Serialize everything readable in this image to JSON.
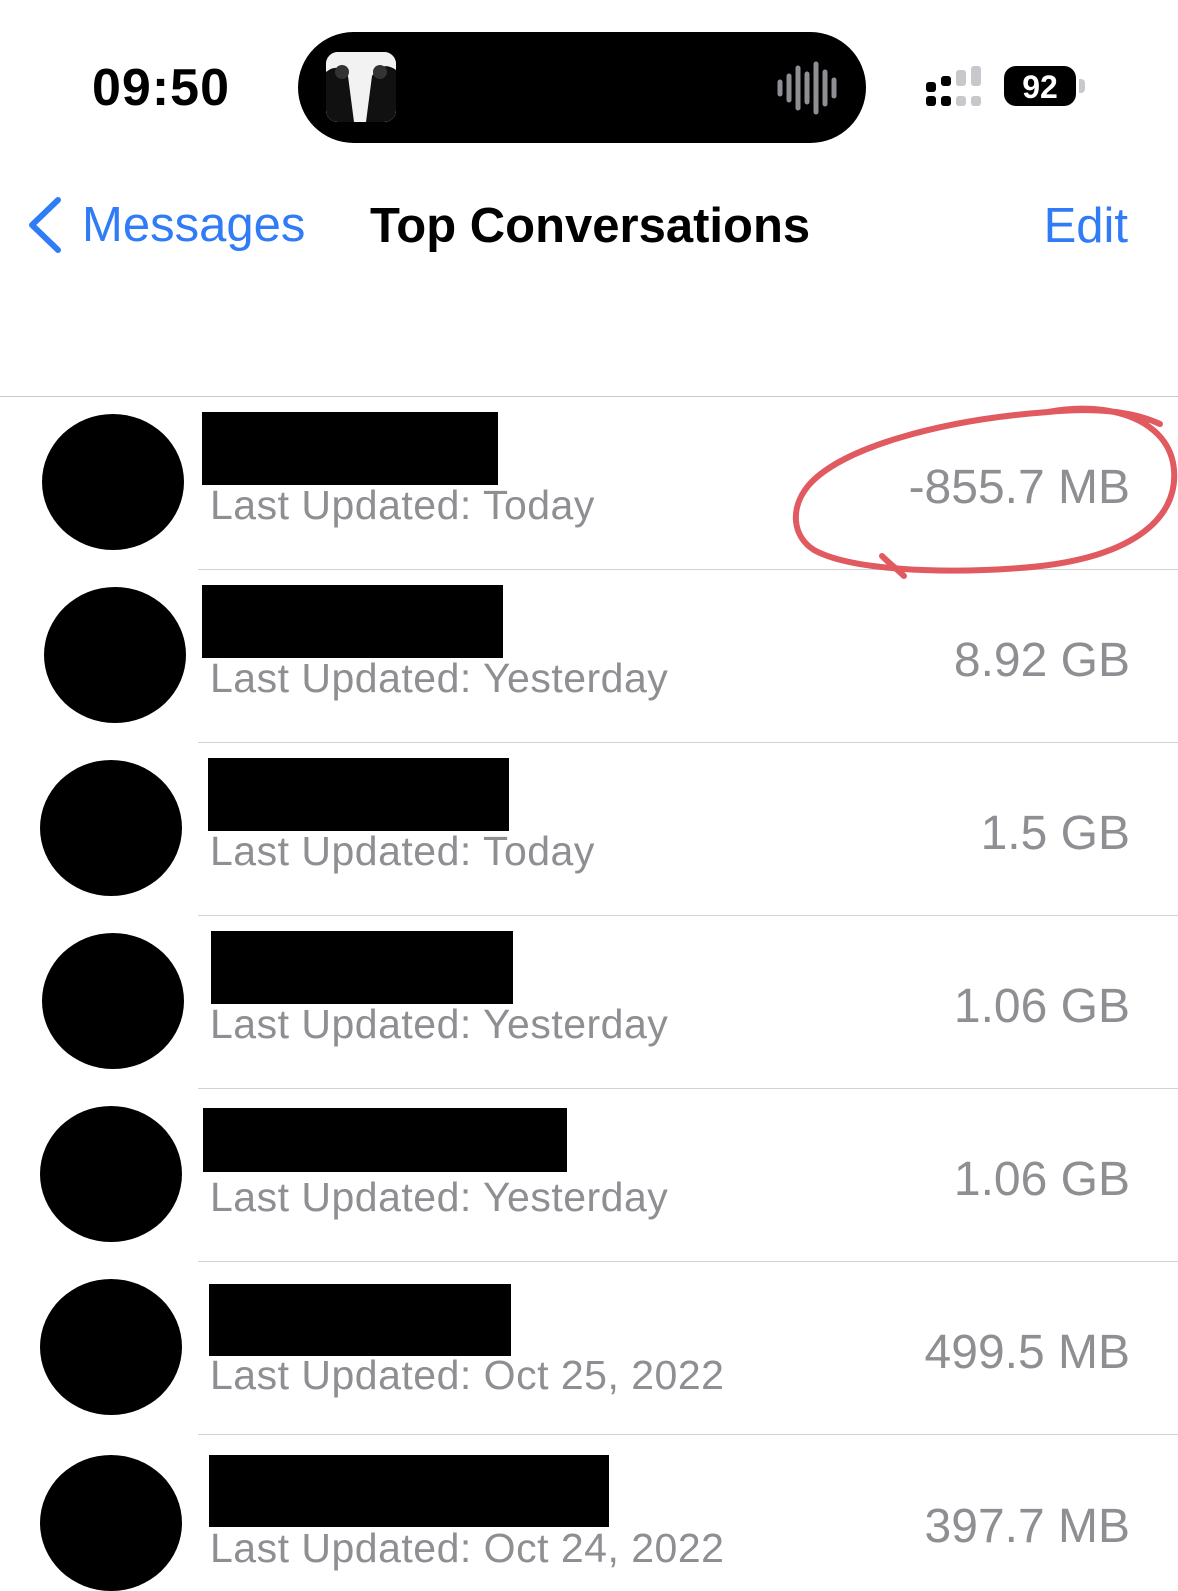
{
  "status_bar": {
    "time": "09:50",
    "battery": "92"
  },
  "nav": {
    "back_label": "Messages",
    "title": "Top Conversations",
    "edit_label": "Edit"
  },
  "conversations": [
    {
      "subtitle": "Last Updated: Today",
      "size": "-855.7 MB"
    },
    {
      "subtitle": "Last Updated: Yesterday",
      "size": "8.92 GB"
    },
    {
      "subtitle": "Last Updated: Today",
      "size": "1.5 GB"
    },
    {
      "subtitle": "Last Updated: Yesterday",
      "size": "1.06 GB"
    },
    {
      "subtitle": "Last Updated: Yesterday",
      "size": "1.06 GB"
    },
    {
      "subtitle": "Last Updated: Oct 25, 2022",
      "size": "499.5 MB"
    },
    {
      "subtitle": "Last Updated: Oct 24, 2022",
      "size": "397.7 MB"
    }
  ],
  "colors": {
    "accent": "#2f7cf6",
    "secondary_text": "#8e8e93",
    "annotation": "#e05a60"
  },
  "icons": [
    "back-chevron-icon",
    "audio-waveform-icon",
    "cellular-signal-icon",
    "battery-icon"
  ]
}
